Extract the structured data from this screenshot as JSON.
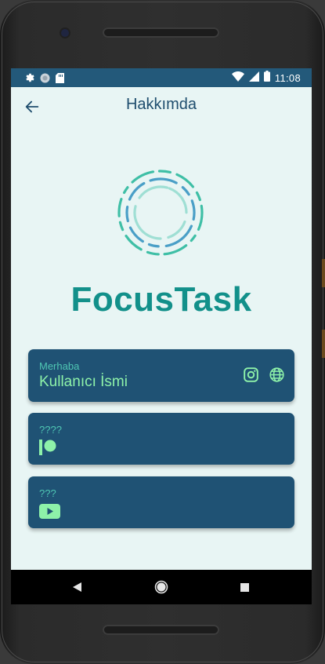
{
  "status_bar": {
    "time": "11:08"
  },
  "app_bar": {
    "title": "Hakkımda"
  },
  "brand": {
    "name": "FocusTask"
  },
  "profile_card": {
    "greeting": "Merhaba",
    "username": "Kullanıcı İsmi"
  },
  "patreon_card": {
    "label": "????"
  },
  "youtube_card": {
    "label": "???"
  },
  "icons": {
    "back": "arrow-left",
    "instagram": "instagram",
    "website": "globe",
    "patreon": "patreon",
    "youtube": "youtube-play",
    "settings": "gear",
    "notification": "circle",
    "sd_card": "sd-card",
    "wifi": "wifi",
    "signal": "signal",
    "battery": "battery",
    "nav_back": "triangle-back",
    "nav_home": "circle-home",
    "nav_recents": "square-recents"
  },
  "colors": {
    "status_bar": "#23597a",
    "background": "#e8f5f4",
    "card": "#1f5274",
    "accent_green": "#8ef2a9",
    "accent_teal": "#4fc6b3",
    "brand": "#12908a",
    "title": "#1f4e6e"
  }
}
